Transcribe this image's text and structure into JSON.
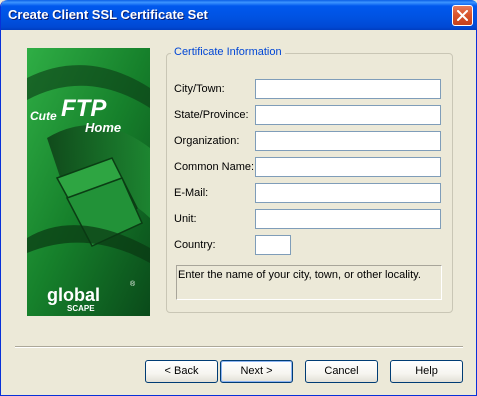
{
  "window": {
    "title": "Create Client SSL Certificate Set"
  },
  "banner": {
    "logo_top_line1": "Cute",
    "logo_top_line2": "FTP",
    "logo_top_line3": "Home",
    "logo_bottom_line1": "global",
    "logo_bottom_line2": "SCAPE",
    "logo_trademark": "®"
  },
  "fieldset": {
    "legend": "Certificate Information"
  },
  "fields": [
    {
      "label": "City/Town:",
      "value": ""
    },
    {
      "label": "State/Province:",
      "value": ""
    },
    {
      "label": "Organization:",
      "value": ""
    },
    {
      "label": "Common Name:",
      "value": ""
    },
    {
      "label": "E-Mail:",
      "value": ""
    },
    {
      "label": "Unit:",
      "value": ""
    },
    {
      "label": "Country:",
      "value": ""
    }
  ],
  "help_text": "Enter the name of your city, town, or other locality.",
  "buttons": {
    "back": "< Back",
    "next": "Next >",
    "cancel": "Cancel",
    "help": "Help"
  },
  "colors": {
    "title_bar": "#0054e3",
    "legend_text": "#0046d5",
    "banner_green": "#1a8a2e"
  }
}
